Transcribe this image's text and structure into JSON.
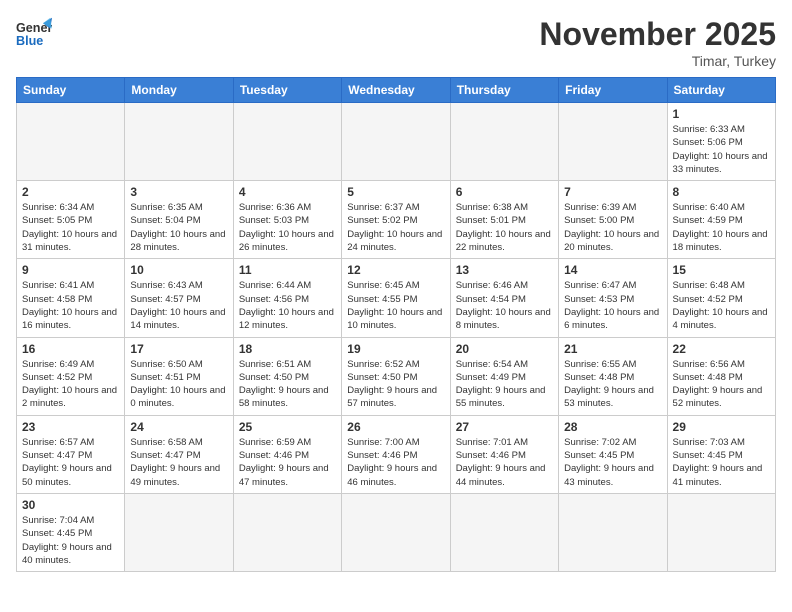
{
  "header": {
    "logo_general": "General",
    "logo_blue": "Blue",
    "month_title": "November 2025",
    "location": "Timar, Turkey"
  },
  "weekdays": [
    "Sunday",
    "Monday",
    "Tuesday",
    "Wednesday",
    "Thursday",
    "Friday",
    "Saturday"
  ],
  "weeks": [
    [
      {
        "day": "",
        "info": ""
      },
      {
        "day": "",
        "info": ""
      },
      {
        "day": "",
        "info": ""
      },
      {
        "day": "",
        "info": ""
      },
      {
        "day": "",
        "info": ""
      },
      {
        "day": "",
        "info": ""
      },
      {
        "day": "1",
        "info": "Sunrise: 6:33 AM\nSunset: 5:06 PM\nDaylight: 10 hours and 33 minutes."
      }
    ],
    [
      {
        "day": "2",
        "info": "Sunrise: 6:34 AM\nSunset: 5:05 PM\nDaylight: 10 hours and 31 minutes."
      },
      {
        "day": "3",
        "info": "Sunrise: 6:35 AM\nSunset: 5:04 PM\nDaylight: 10 hours and 28 minutes."
      },
      {
        "day": "4",
        "info": "Sunrise: 6:36 AM\nSunset: 5:03 PM\nDaylight: 10 hours and 26 minutes."
      },
      {
        "day": "5",
        "info": "Sunrise: 6:37 AM\nSunset: 5:02 PM\nDaylight: 10 hours and 24 minutes."
      },
      {
        "day": "6",
        "info": "Sunrise: 6:38 AM\nSunset: 5:01 PM\nDaylight: 10 hours and 22 minutes."
      },
      {
        "day": "7",
        "info": "Sunrise: 6:39 AM\nSunset: 5:00 PM\nDaylight: 10 hours and 20 minutes."
      },
      {
        "day": "8",
        "info": "Sunrise: 6:40 AM\nSunset: 4:59 PM\nDaylight: 10 hours and 18 minutes."
      }
    ],
    [
      {
        "day": "9",
        "info": "Sunrise: 6:41 AM\nSunset: 4:58 PM\nDaylight: 10 hours and 16 minutes."
      },
      {
        "day": "10",
        "info": "Sunrise: 6:43 AM\nSunset: 4:57 PM\nDaylight: 10 hours and 14 minutes."
      },
      {
        "day": "11",
        "info": "Sunrise: 6:44 AM\nSunset: 4:56 PM\nDaylight: 10 hours and 12 minutes."
      },
      {
        "day": "12",
        "info": "Sunrise: 6:45 AM\nSunset: 4:55 PM\nDaylight: 10 hours and 10 minutes."
      },
      {
        "day": "13",
        "info": "Sunrise: 6:46 AM\nSunset: 4:54 PM\nDaylight: 10 hours and 8 minutes."
      },
      {
        "day": "14",
        "info": "Sunrise: 6:47 AM\nSunset: 4:53 PM\nDaylight: 10 hours and 6 minutes."
      },
      {
        "day": "15",
        "info": "Sunrise: 6:48 AM\nSunset: 4:52 PM\nDaylight: 10 hours and 4 minutes."
      }
    ],
    [
      {
        "day": "16",
        "info": "Sunrise: 6:49 AM\nSunset: 4:52 PM\nDaylight: 10 hours and 2 minutes."
      },
      {
        "day": "17",
        "info": "Sunrise: 6:50 AM\nSunset: 4:51 PM\nDaylight: 10 hours and 0 minutes."
      },
      {
        "day": "18",
        "info": "Sunrise: 6:51 AM\nSunset: 4:50 PM\nDaylight: 9 hours and 58 minutes."
      },
      {
        "day": "19",
        "info": "Sunrise: 6:52 AM\nSunset: 4:50 PM\nDaylight: 9 hours and 57 minutes."
      },
      {
        "day": "20",
        "info": "Sunrise: 6:54 AM\nSunset: 4:49 PM\nDaylight: 9 hours and 55 minutes."
      },
      {
        "day": "21",
        "info": "Sunrise: 6:55 AM\nSunset: 4:48 PM\nDaylight: 9 hours and 53 minutes."
      },
      {
        "day": "22",
        "info": "Sunrise: 6:56 AM\nSunset: 4:48 PM\nDaylight: 9 hours and 52 minutes."
      }
    ],
    [
      {
        "day": "23",
        "info": "Sunrise: 6:57 AM\nSunset: 4:47 PM\nDaylight: 9 hours and 50 minutes."
      },
      {
        "day": "24",
        "info": "Sunrise: 6:58 AM\nSunset: 4:47 PM\nDaylight: 9 hours and 49 minutes."
      },
      {
        "day": "25",
        "info": "Sunrise: 6:59 AM\nSunset: 4:46 PM\nDaylight: 9 hours and 47 minutes."
      },
      {
        "day": "26",
        "info": "Sunrise: 7:00 AM\nSunset: 4:46 PM\nDaylight: 9 hours and 46 minutes."
      },
      {
        "day": "27",
        "info": "Sunrise: 7:01 AM\nSunset: 4:46 PM\nDaylight: 9 hours and 44 minutes."
      },
      {
        "day": "28",
        "info": "Sunrise: 7:02 AM\nSunset: 4:45 PM\nDaylight: 9 hours and 43 minutes."
      },
      {
        "day": "29",
        "info": "Sunrise: 7:03 AM\nSunset: 4:45 PM\nDaylight: 9 hours and 41 minutes."
      }
    ],
    [
      {
        "day": "30",
        "info": "Sunrise: 7:04 AM\nSunset: 4:45 PM\nDaylight: 9 hours and 40 minutes."
      },
      {
        "day": "",
        "info": ""
      },
      {
        "day": "",
        "info": ""
      },
      {
        "day": "",
        "info": ""
      },
      {
        "day": "",
        "info": ""
      },
      {
        "day": "",
        "info": ""
      },
      {
        "day": "",
        "info": ""
      }
    ]
  ]
}
